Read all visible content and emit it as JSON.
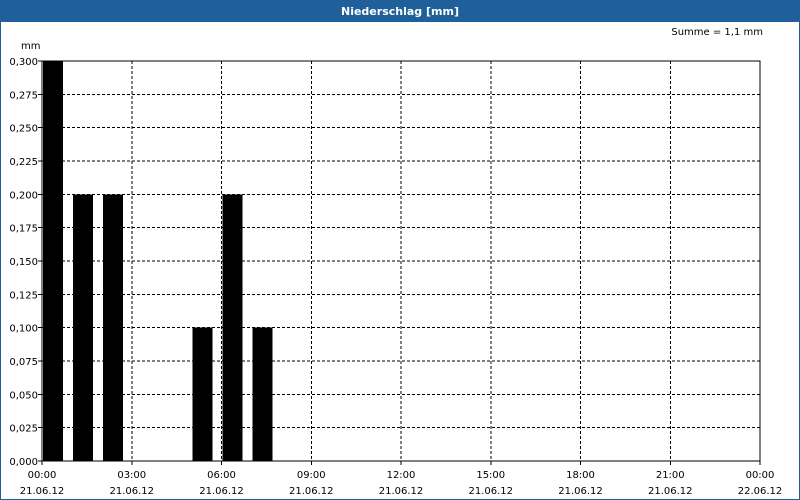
{
  "window": {
    "title": "Niederschlag [mm]"
  },
  "summary": "Summe = 1,1 mm",
  "chart_data": {
    "type": "bar",
    "title": "Niederschlag [mm]",
    "ylabel": "mm",
    "ylim": [
      0,
      0.3
    ],
    "yticks": [
      "0,300",
      "0,275",
      "0,250",
      "0,225",
      "0,200",
      "0,175",
      "0,150",
      "0,125",
      "0,100",
      "0,075",
      "0,050",
      "0,025",
      "0,000"
    ],
    "xticks": [
      {
        "time": "00:00",
        "date": "21.06.12"
      },
      {
        "time": "03:00",
        "date": "21.06.12"
      },
      {
        "time": "06:00",
        "date": "21.06.12"
      },
      {
        "time": "09:00",
        "date": "21.06.12"
      },
      {
        "time": "12:00",
        "date": "21.06.12"
      },
      {
        "time": "15:00",
        "date": "21.06.12"
      },
      {
        "time": "18:00",
        "date": "21.06.12"
      },
      {
        "time": "21:00",
        "date": "21.06.12"
      },
      {
        "time": "00:00",
        "date": "22.06.12"
      }
    ],
    "categories": [
      "00:00",
      "01:00",
      "02:00",
      "03:00",
      "04:00",
      "05:00",
      "06:00",
      "07:00",
      "08:00",
      "09:00",
      "10:00",
      "11:00",
      "12:00",
      "13:00",
      "14:00",
      "15:00",
      "16:00",
      "17:00",
      "18:00",
      "19:00",
      "20:00",
      "21:00",
      "22:00",
      "23:00"
    ],
    "values": [
      0.3,
      0.2,
      0.2,
      0,
      0,
      0.1,
      0.2,
      0.1,
      0,
      0,
      0,
      0,
      0,
      0,
      0,
      0,
      0,
      0,
      0,
      0,
      0,
      0,
      0,
      0
    ],
    "grid": true,
    "bar_color": "#000000"
  }
}
